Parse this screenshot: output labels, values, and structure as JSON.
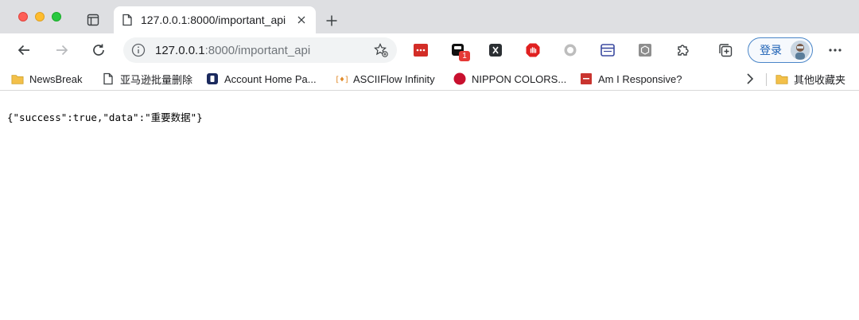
{
  "tab": {
    "title": "127.0.0.1:8000/important_api"
  },
  "address_bar": {
    "host": "127.0.0.1",
    "path": ":8000/important_api"
  },
  "extensions": {
    "badge_count": "1"
  },
  "profile": {
    "login_label": "登录"
  },
  "bookmarks": [
    {
      "label": "NewsBreak",
      "icon": "folder-icon"
    },
    {
      "label": "亚马逊批量删除",
      "icon": "page-icon"
    },
    {
      "label": "Account Home Pa...",
      "icon": "account-icon"
    },
    {
      "label": "ASCIIFlow Infinity",
      "icon": "asciiflow-icon"
    },
    {
      "label": "NIPPON COLORS...",
      "icon": "nippon-colors-icon"
    },
    {
      "label": "Am I Responsive?",
      "icon": "responsive-icon"
    },
    {
      "label": "其他收藏夹",
      "icon": "folder-icon"
    }
  ],
  "page": {
    "body_text": "{\"success\":true,\"data\":\"重要数据\"}"
  },
  "colors": {
    "tabbar": "#dedfe2",
    "accent": "#1a5fb4",
    "folder": "#f3c04a"
  }
}
